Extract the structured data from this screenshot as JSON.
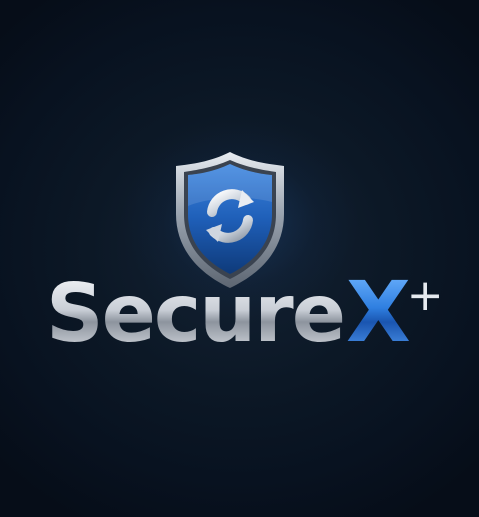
{
  "logo": {
    "icon": "shield-icon",
    "emblem": "circular-arrows-icon",
    "word_main": "Secure",
    "word_accent": "X",
    "word_sup": "+",
    "colors": {
      "background": "#0a1522",
      "shield_blue": "#1f5fb8",
      "shield_rim": "#9aa4b0",
      "text_silver": "#c9ced6",
      "accent_blue": "#2f7fe0"
    }
  }
}
